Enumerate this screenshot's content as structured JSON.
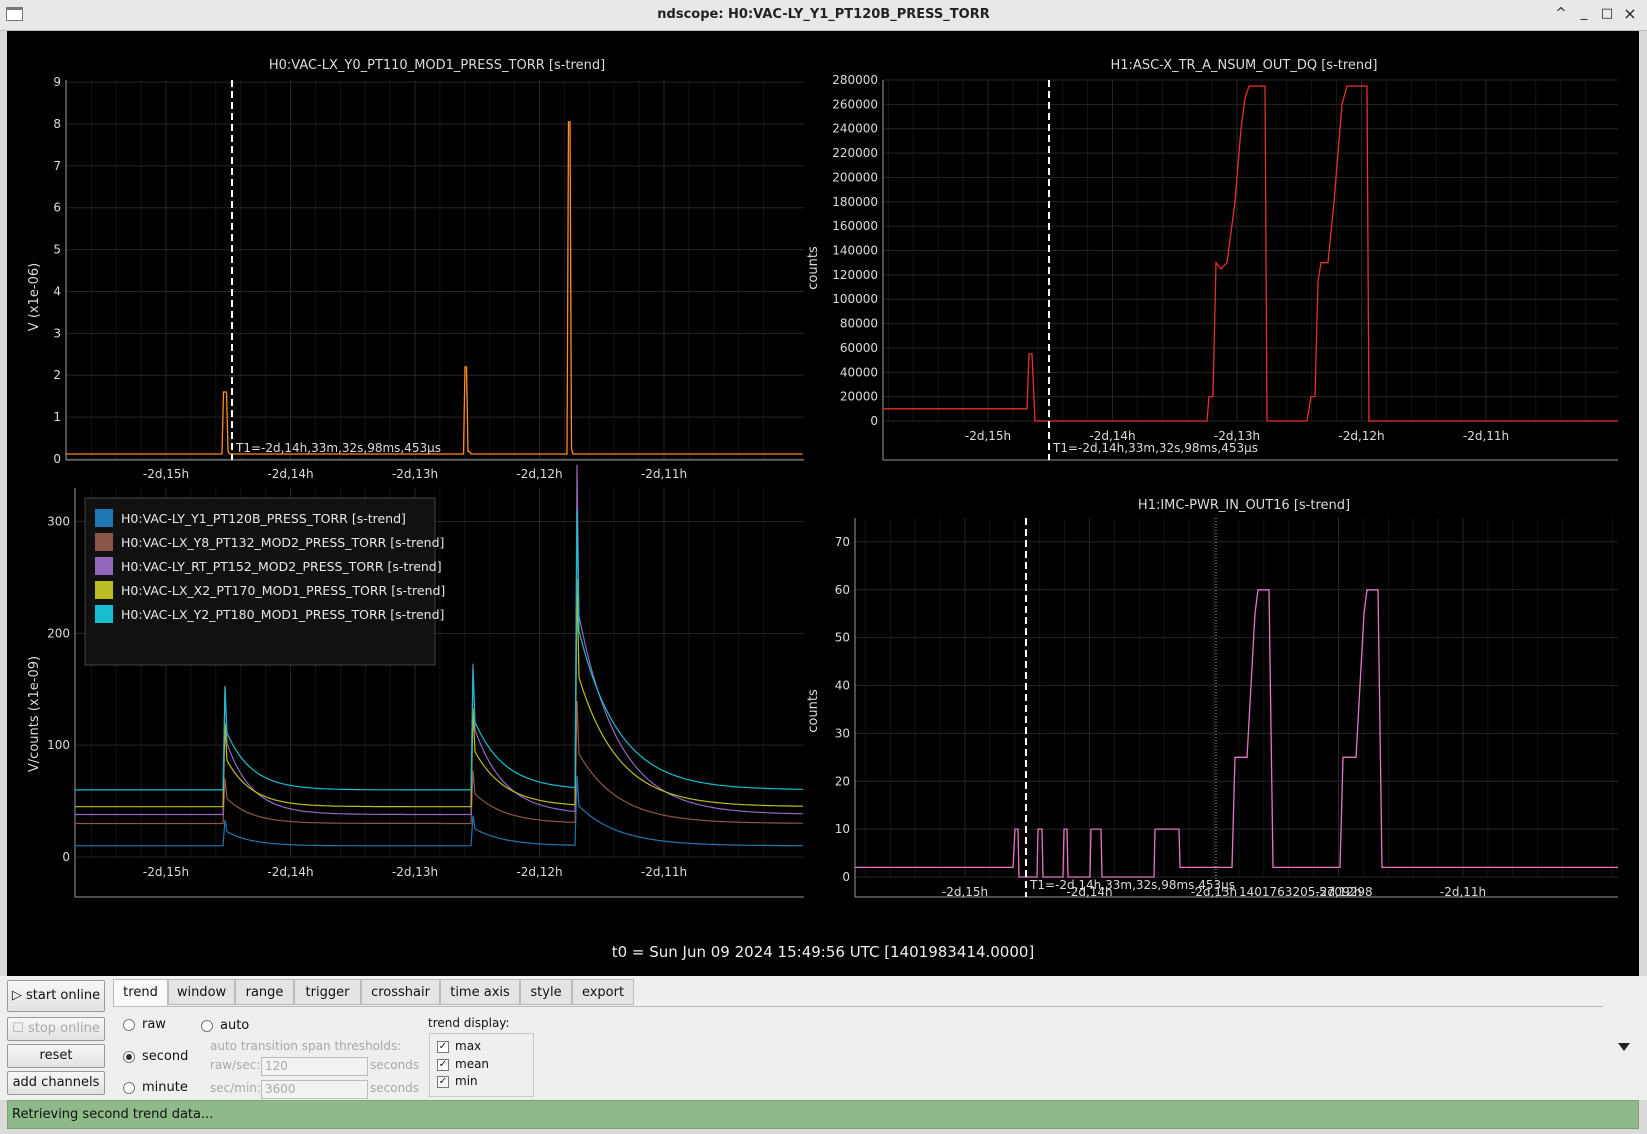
{
  "window": {
    "title": "ndscope: H0:VAC-LY_Y1_PT120B_PRESS_TORR",
    "controls": [
      "^",
      "_",
      "□",
      "×"
    ]
  },
  "plots": {
    "tl": {
      "title": "H0:VAC-LX_Y0_PT110_MOD1_PRESS_TORR [s-trend]",
      "ylabel": "V (x1e-06)",
      "yticks": [
        "0",
        "1",
        "2",
        "3",
        "4",
        "5",
        "6",
        "7",
        "8",
        "9"
      ],
      "xticks": [
        "-2d,15h",
        "-2d,14h",
        "-2d,13h",
        "-2d,12h",
        "-2d,11h"
      ],
      "cursor_label": "T1=-2d,14h,33m,32s,98ms,453µs",
      "color": "#ff8c1a"
    },
    "tr": {
      "title": "H1:ASC-X_TR_A_NSUM_OUT_DQ [s-trend]",
      "ylabel": "counts",
      "yticks": [
        "0",
        "20000",
        "40000",
        "60000",
        "80000",
        "100000",
        "120000",
        "140000",
        "160000",
        "180000",
        "200000",
        "220000",
        "240000",
        "260000",
        "280000"
      ],
      "xticks": [
        "-2d,15h",
        "-2d,14h",
        "-2d,13h",
        "-2d,12h",
        "-2d,11h"
      ],
      "cursor_label": "T1=-2d,14h,33m,32s,98ms,453µs",
      "color": "#e8302a"
    },
    "bl": {
      "ylabel": "V/counts (x1e-09)",
      "yticks": [
        "0",
        "100",
        "200",
        "300"
      ],
      "xticks": [
        "-2d,15h",
        "-2d,14h",
        "-2d,13h",
        "-2d,12h",
        "-2d,11h"
      ],
      "legend": [
        {
          "label": "H0:VAC-LY_Y1_PT120B_PRESS_TORR [s-trend]",
          "color": "#1f77b4"
        },
        {
          "label": "H0:VAC-LX_Y8_PT132_MOD2_PRESS_TORR [s-trend]",
          "color": "#8c564b"
        },
        {
          "label": "H0:VAC-LY_RT_PT152_MOD2_PRESS_TORR [s-trend]",
          "color": "#9467bd"
        },
        {
          "label": "H0:VAC-LX_X2_PT170_MOD1_PRESS_TORR [s-trend]",
          "color": "#bcbd22"
        },
        {
          "label": "H0:VAC-LX_Y2_PT180_MOD1_PRESS_TORR [s-trend]",
          "color": "#17becf"
        }
      ]
    },
    "br": {
      "title": "H1:IMC-PWR_IN_OUT16 [s-trend]",
      "ylabel": "counts",
      "yticks": [
        "0",
        "10",
        "20",
        "30",
        "40",
        "50",
        "60",
        "70"
      ],
      "xticks": [
        "-2d,15h",
        "-2d,14h",
        "-2d,13h",
        "-2d,12h",
        "-2d,11h"
      ],
      "cursor_label": "T1=-2d,14h,33m,32s,98ms,453µs",
      "cursor2_label": "1401763205.5709298",
      "color": "#e377c2"
    }
  },
  "t0_label": "t0 = Sun Jun 09 2024 15:49:56 UTC [1401983414.0000]",
  "left_buttons": {
    "start": "▷ start online",
    "stop": "☐ stop online",
    "reset": "reset",
    "add": "add channels"
  },
  "tabs": [
    "trend",
    "window",
    "range",
    "trigger",
    "crosshair",
    "time axis",
    "style",
    "export"
  ],
  "trend_panel": {
    "raw": "raw",
    "second": "second",
    "minute": "minute",
    "auto": "auto",
    "auto_label": "auto transition span thresholds:",
    "raw_sec_label": "raw/sec:",
    "raw_sec_value": "120",
    "sec_min_label": "sec/min:",
    "sec_min_value": "3600",
    "seconds": "seconds",
    "selected": "second",
    "display_label": "trend display:",
    "max": "max",
    "mean": "mean",
    "min": "min"
  },
  "status": "Retrieving second trend data..."
}
